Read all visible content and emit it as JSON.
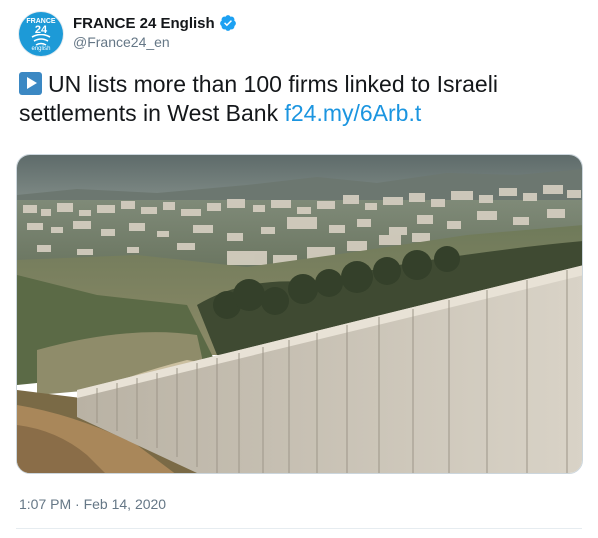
{
  "account": {
    "display_name": "FRANCE 24 English",
    "handle": "@France24_en",
    "logo_line1": "FRANCE",
    "logo_line2": "24",
    "logo_line3": "english",
    "brand_color": "#1d9ad7",
    "verified_color": "#1da1f2"
  },
  "tweet": {
    "text": "UN lists more than 100 firms linked to Israeli settlements in West Bank",
    "link": "f24.my/6Arb.t",
    "link_color": "#1b95e0",
    "leading_icon": "play-button-icon",
    "timestamp": "1:07 PM · Feb 14, 2020"
  },
  "media": {
    "type": "photo",
    "subject": "separation-wall-and-hillside-settlement-photo"
  }
}
